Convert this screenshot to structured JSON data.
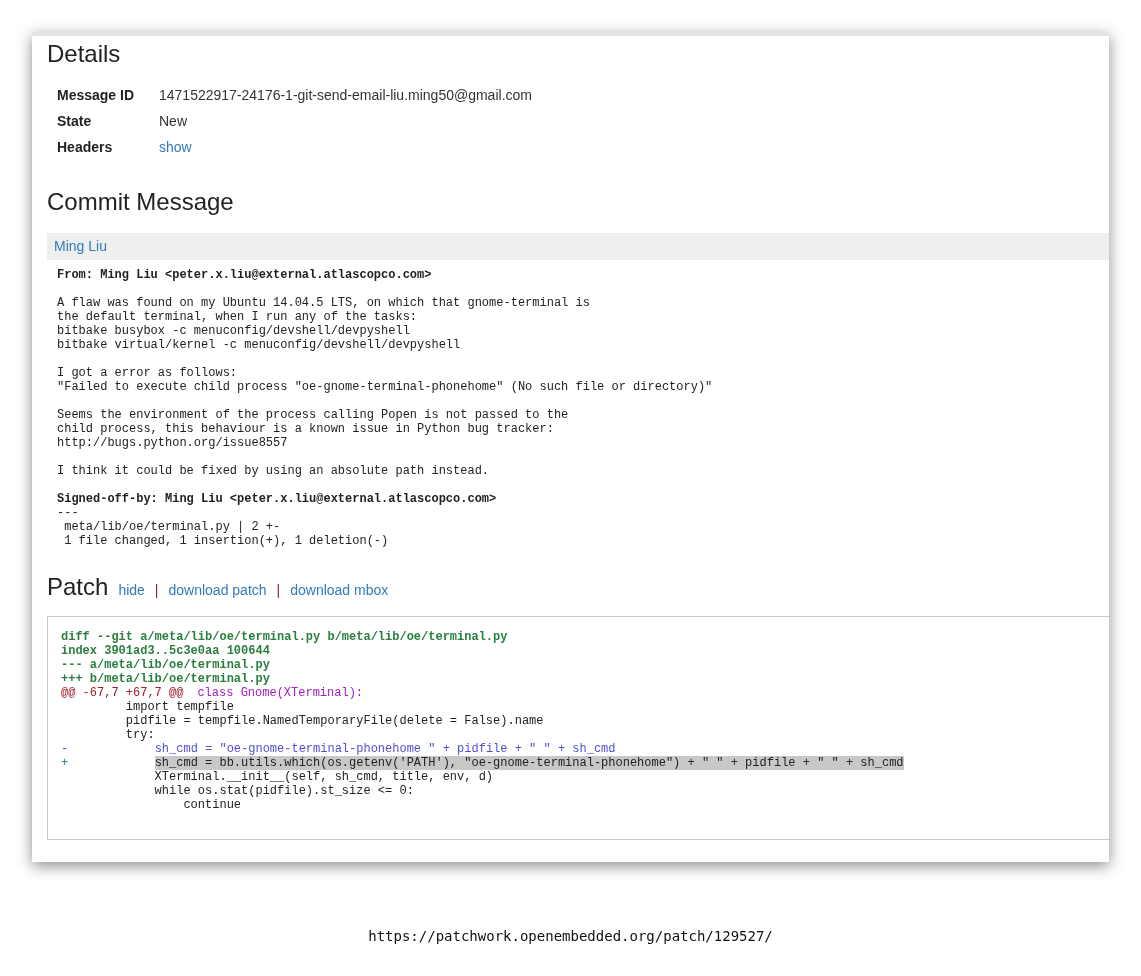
{
  "details": {
    "title": "Details",
    "rows": [
      {
        "label": "Message ID",
        "value": "1471522917-24176-1-git-send-email-liu.ming50@gmail.com",
        "kind": "text"
      },
      {
        "label": "State",
        "value": "New",
        "kind": "text"
      },
      {
        "label": "Headers",
        "value": "show",
        "kind": "link"
      }
    ]
  },
  "commit_message": {
    "title": "Commit Message",
    "author": "Ming Liu",
    "blocks": [
      [
        {
          "text": "From: Ming Liu <peter.x.liu@external.atlascopco.com>",
          "bold": true
        }
      ],
      [
        {
          "text": "A flaw was found on my Ubuntu 14.04.5 LTS, on which that gnome-terminal is",
          "bold": false
        },
        {
          "text": "the default terminal, when I run any of the tasks:",
          "bold": false
        },
        {
          "text": "bitbake busybox -c menuconfig/devshell/devpyshell",
          "bold": false
        },
        {
          "text": "bitbake virtual/kernel -c menuconfig/devshell/devpyshell",
          "bold": false
        }
      ],
      [
        {
          "text": "I got a error as follows:",
          "bold": false
        },
        {
          "text": "\"Failed to execute child process \"oe-gnome-terminal-phonehome\" (No such file or directory)\"",
          "bold": false
        }
      ],
      [
        {
          "text": "Seems the environment of the process calling Popen is not passed to the",
          "bold": false
        },
        {
          "text": "child process, this behaviour is a known issue in Python bug tracker:",
          "bold": false
        },
        {
          "text": "http://bugs.python.org/issue8557",
          "bold": false
        }
      ],
      [
        {
          "text": "I think it could be fixed by using an absolute path instead.",
          "bold": false
        }
      ],
      [
        {
          "text": "Signed-off-by: Ming Liu <peter.x.liu@external.atlascopco.com>",
          "bold": true
        },
        {
          "text": "---",
          "bold": false
        },
        {
          "text": " meta/lib/oe/terminal.py | 2 +-",
          "bold": false
        },
        {
          "text": " 1 file changed, 1 insertion(+), 1 deletion(-)",
          "bold": false
        }
      ]
    ]
  },
  "patch": {
    "title": "Patch",
    "links": [
      "hide",
      "download patch",
      "download mbox"
    ],
    "separator": "|",
    "lines": [
      {
        "kind": "meta",
        "text": "diff --git a/meta/lib/oe/terminal.py b/meta/lib/oe/terminal.py"
      },
      {
        "kind": "meta",
        "text": "index 3901ad3..5c3e0aa 100644"
      },
      {
        "kind": "meta",
        "text": "--- a/meta/lib/oe/terminal.py"
      },
      {
        "kind": "meta",
        "text": "+++ b/meta/lib/oe/terminal.py"
      },
      {
        "kind": "hunk",
        "range": "@@ -67,7 +67,7 @@",
        "section": "class Gnome(XTerminal):"
      },
      {
        "kind": "context",
        "text": "         import tempfile"
      },
      {
        "kind": "context",
        "text": "         pidfile = tempfile.NamedTemporaryFile(delete = False).name"
      },
      {
        "kind": "context",
        "text": "         try:"
      },
      {
        "kind": "removed",
        "marker": "-",
        "text": "            sh_cmd = \"oe-gnome-terminal-phonehome \" + pidfile + \" \" + sh_cmd"
      },
      {
        "kind": "added",
        "marker": "+",
        "text": "            sh_cmd = bb.utils.which(os.getenv('PATH'), \"oe-gnome-terminal-phonehome\") + \" \" + pidfile + \" \" + sh_cmd"
      },
      {
        "kind": "context",
        "text": "             XTerminal.__init__(self, sh_cmd, title, env, d)"
      },
      {
        "kind": "context",
        "text": "             while os.stat(pidfile).st_size <= 0:"
      },
      {
        "kind": "context",
        "text": "                 continue"
      }
    ]
  },
  "caption": "https://patchwork.openembedded.org/patch/129527/"
}
